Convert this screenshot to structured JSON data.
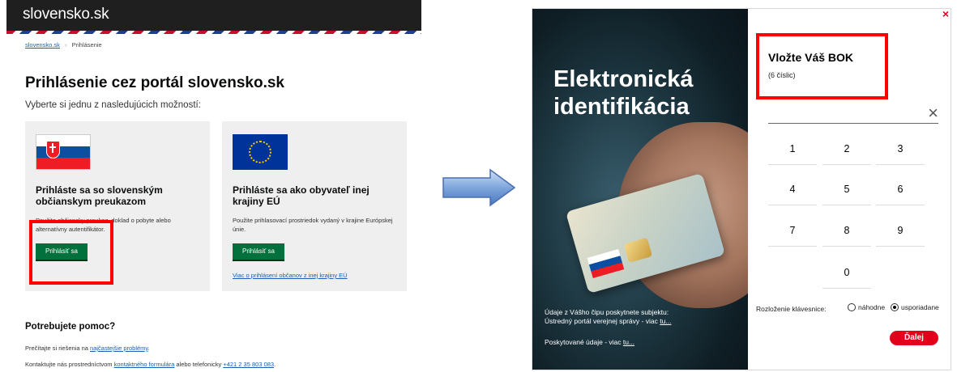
{
  "portal": {
    "brand": "slovensko.sk",
    "breadcrumb": {
      "home": "slovensko.sk",
      "current": "Prihlásenie"
    },
    "title": "Prihlásenie cez portál slovensko.sk",
    "subtitle": "Vyberte si jednu z nasledujúcich možností:",
    "cards": [
      {
        "title": "Prihláste sa so slovenským občianskym preukazom",
        "desc": "Použite občiansky preukaz, doklad o pobyte alebo alternatívny autentifikátor.",
        "button": "Prihlásiť sa",
        "flag": "slovakia-flag"
      },
      {
        "title": "Prihláste sa ako obyvateľ inej krajiny EÚ",
        "desc": "Použite prihlasovací prostriedok vydaný v krajine Európskej únie.",
        "button": "Prihlásiť sa",
        "link": "Viac o prihlásení občanov z inej krajiny EÚ",
        "flag": "eu-flag"
      }
    ],
    "help": {
      "title": "Potrebujete pomoc?",
      "line1_pre": "Prečítajte si riešenia na ",
      "line1_link": "najčastejšie problémy",
      "line1_post": ".",
      "line2_pre": "Kontaktujte nás prostredníctvom ",
      "line2_link": "kontaktného formulára",
      "line2_mid": " alebo telefonicky ",
      "line2_phone": "+421 2 35 803 083",
      "line2_post": "."
    }
  },
  "dialog": {
    "photo_title_1": "Elektronická",
    "photo_title_2": "identifikácia",
    "note1_line1": "Údaje z Vášho čipu poskytnete subjektu:",
    "note1_line2": "Ústredný portál verejnej správy - viac ",
    "note1_link": "tu...",
    "note2_text": "Poskytované údaje - viac ",
    "note2_link": "tu...",
    "close": "×",
    "bok_title": "Vložte Váš BOK",
    "bok_sub": "(6 číslic)",
    "clear": "×",
    "keys": [
      "1",
      "2",
      "3",
      "4",
      "5",
      "6",
      "7",
      "8",
      "9",
      "0"
    ],
    "layout_label": "Rozloženie klávesnice:",
    "option_random": "náhodne",
    "option_ordered": "usporiadane",
    "selected_option": "usporiadane",
    "next_button": "Ďalej"
  },
  "colors": {
    "accent_red": "#e3001b",
    "portal_green": "#00703c",
    "highlight_red": "#ff0000"
  }
}
